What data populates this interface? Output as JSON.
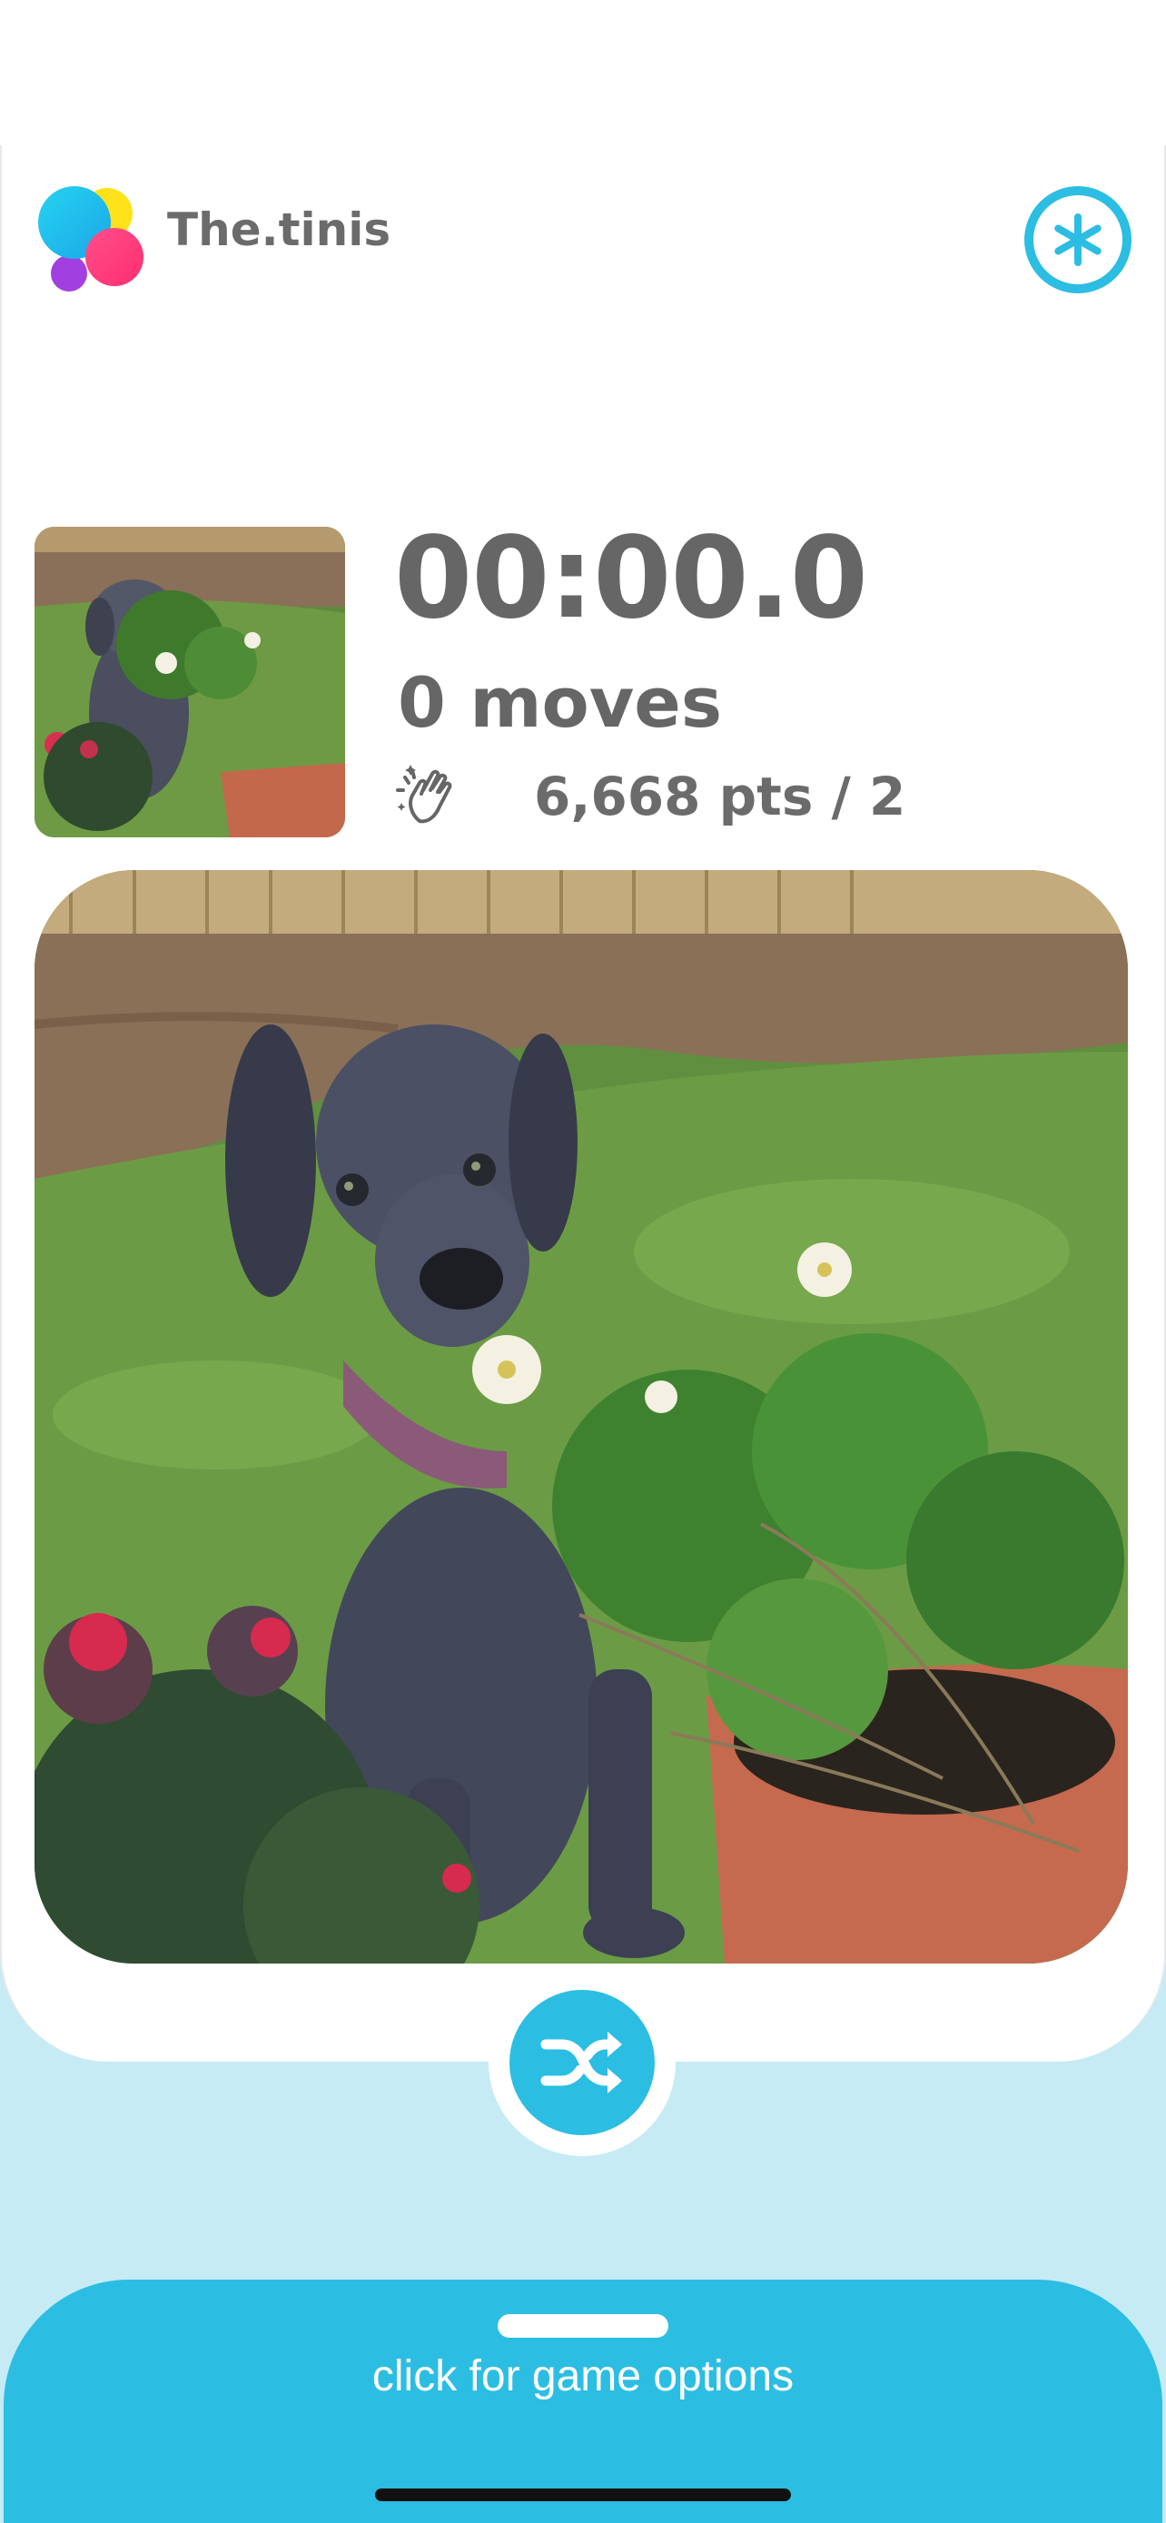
{
  "app": {
    "name": "The.tinis",
    "logo_icon": "overlapping-color-circles-logo",
    "settings_icon": "asterisk-icon"
  },
  "stats": {
    "timer": "00:00.0",
    "moves": "0 moves",
    "points": "6,668 pts / 2",
    "clap_icon": "clapping-hands-icon"
  },
  "puzzle": {
    "preview_icon": "dog-photo-thumbnail",
    "board_icon": "dog-photo-puzzle"
  },
  "controls": {
    "shuffle_icon": "shuffle-icon"
  },
  "sheet": {
    "label": "click for game options"
  },
  "colors": {
    "accent": "#2cbde2",
    "accent_light": "#c6ebf5",
    "text": "#666666"
  }
}
